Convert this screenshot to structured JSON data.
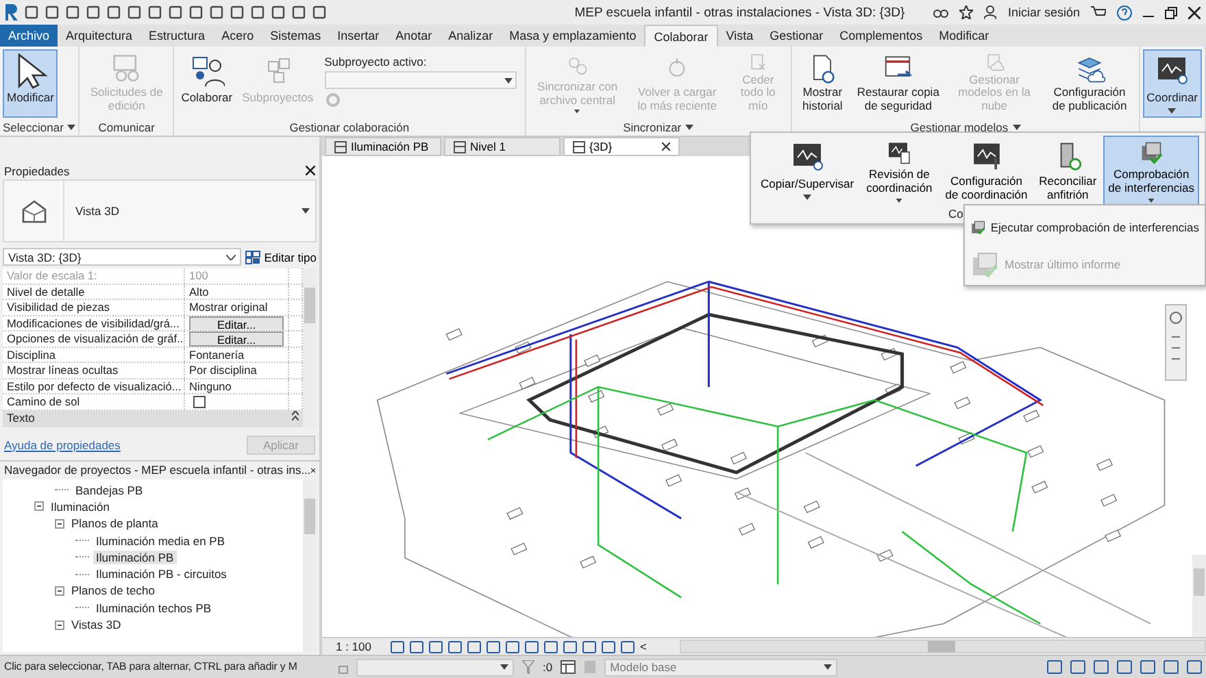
{
  "title_bar": {
    "title": "MEP escuela infantil - otras instalaciones - Vista 3D: {3D}",
    "sign_in": "Iniciar sesión"
  },
  "menu_tabs": [
    {
      "label": "Archivo",
      "kind": "file",
      "selected": false
    },
    {
      "label": "Arquitectura",
      "kind": "tab",
      "selected": false
    },
    {
      "label": "Estructura",
      "kind": "tab",
      "selected": false
    },
    {
      "label": "Acero",
      "kind": "tab",
      "selected": false
    },
    {
      "label": "Sistemas",
      "kind": "tab",
      "selected": false
    },
    {
      "label": "Insertar",
      "kind": "tab",
      "selected": false
    },
    {
      "label": "Anotar",
      "kind": "tab",
      "selected": false
    },
    {
      "label": "Analizar",
      "kind": "tab",
      "selected": false
    },
    {
      "label": "Masa y emplazamiento",
      "kind": "tab",
      "selected": false
    },
    {
      "label": "Colaborar",
      "kind": "tab",
      "selected": true
    },
    {
      "label": "Vista",
      "kind": "tab",
      "selected": false
    },
    {
      "label": "Gestionar",
      "kind": "tab",
      "selected": false
    },
    {
      "label": "Complementos",
      "kind": "tab",
      "selected": false
    },
    {
      "label": "Modificar",
      "kind": "tab",
      "selected": false
    }
  ],
  "ribbon": {
    "groups": [
      {
        "title": "Seleccionar",
        "has_menu": true,
        "buttons": [
          {
            "kind": "large",
            "label": "Modificar",
            "selected": true,
            "disabled": false
          }
        ]
      },
      {
        "title": "Comunicar",
        "buttons": [
          {
            "kind": "large",
            "label": "Solicitudes de edición",
            "selected": false,
            "disabled": true
          }
        ]
      },
      {
        "title": "Gestionar colaboración",
        "buttons": [
          {
            "kind": "large",
            "label": "Colaborar",
            "selected": false,
            "disabled": false
          },
          {
            "kind": "large",
            "label": "Subproyectos",
            "selected": false,
            "disabled": true
          },
          {
            "kind": "dropdown",
            "label": "Subproyecto activo:",
            "disabled": true
          }
        ]
      },
      {
        "title": "Sincronizar",
        "has_menu": true,
        "buttons": [
          {
            "kind": "large",
            "label": "Sincronizar con archivo central",
            "selected": false,
            "disabled": true,
            "has_menu": true
          },
          {
            "kind": "large",
            "label": "Volver a cargar lo más reciente",
            "selected": false,
            "disabled": true
          },
          {
            "kind": "large",
            "label": "Ceder todo lo mío",
            "selected": false,
            "disabled": true
          }
        ]
      },
      {
        "title": "Gestionar modelos",
        "has_menu": true,
        "buttons": [
          {
            "kind": "large",
            "label": "Mostrar historial",
            "selected": false,
            "disabled": false
          },
          {
            "kind": "large",
            "label": "Restaurar copia de seguridad",
            "selected": false,
            "disabled": false
          },
          {
            "kind": "large",
            "label": "Gestionar modelos en la nube",
            "selected": false,
            "disabled": true
          },
          {
            "kind": "large",
            "label": "Configuración de publicación",
            "selected": false,
            "disabled": false
          }
        ]
      },
      {
        "buttons": [
          {
            "kind": "large",
            "label": "Coordinar",
            "selected": true,
            "disabled": false,
            "has_menu": true
          }
        ]
      }
    ]
  },
  "coordinate_panel": {
    "title": "Co",
    "buttons": [
      {
        "label": "Copiar/Supervisar",
        "selected": false,
        "has_menu": true
      },
      {
        "label": "Revisión de coordinación",
        "selected": false,
        "has_menu": true
      },
      {
        "label": "Configuración de coordinación",
        "selected": false
      },
      {
        "label": "Reconciliar anfitrión",
        "selected": false
      },
      {
        "label": "Comprobación de interferencias",
        "selected": true,
        "has_menu": true
      }
    ],
    "menu": [
      {
        "label": "Ejecutar comprobación de interferencias",
        "disabled": false
      },
      {
        "label": "Mostrar último informe",
        "disabled": true
      }
    ]
  },
  "view_tabs": [
    {
      "label": "Iluminación PB",
      "selected": false
    },
    {
      "label": "Nivel 1",
      "selected": false
    },
    {
      "label": "{3D}",
      "selected": true
    }
  ],
  "properties": {
    "title": "Propiedades",
    "type_name": "Vista 3D",
    "instance": "Vista 3D: {3D}",
    "edit_type": "Editar tipo",
    "rows": [
      {
        "kind": "text",
        "name": "Valor de escala    1:",
        "value": "100",
        "disabled": true
      },
      {
        "kind": "text",
        "name": "Nivel de detalle",
        "value": "Alto",
        "disabled": false
      },
      {
        "kind": "text",
        "name": "Visibilidad de piezas",
        "value": "Mostrar original",
        "disabled": false
      },
      {
        "kind": "button",
        "name": "Modificaciones de visibilidad/grá...",
        "value": "Editar...",
        "disabled": false
      },
      {
        "kind": "button",
        "name": "Opciones de visualización de gráf...",
        "value": "Editar...",
        "disabled": false
      },
      {
        "kind": "text",
        "name": "Disciplina",
        "value": "Fontanería",
        "disabled": false
      },
      {
        "kind": "text",
        "name": "Mostrar líneas ocultas",
        "value": "Por disciplina",
        "disabled": false
      },
      {
        "kind": "text",
        "name": "Estilo por defecto de visualizació...",
        "value": "Ninguno",
        "disabled": false
      },
      {
        "kind": "checkbox",
        "name": "Camino de sol",
        "checked": false,
        "disabled": false
      }
    ],
    "section": "Texto",
    "help": "Ayuda de propiedades",
    "apply": "Aplicar",
    "apply_disabled": true
  },
  "project_browser": {
    "title": "Navegador de proyectos - MEP escuela infantil - otras ins...",
    "tree": [
      {
        "children": [
          {
            "children": [
              {
                "label": "Bandejas PB",
                "selected": false
              }
            ]
          },
          {
            "label": "Iluminación",
            "expanded": true,
            "selected": false,
            "children": [
              {
                "label": "Planos de planta",
                "expanded": true,
                "selected": false,
                "children": [
                  {
                    "label": "Iluminación media en PB",
                    "selected": false
                  },
                  {
                    "label": "Iluminación PB",
                    "selected": true
                  },
                  {
                    "label": "Iluminación PB - circuitos",
                    "selected": false
                  }
                ]
              },
              {
                "label": "Planos de techo",
                "expanded": true,
                "selected": false,
                "children": [
                  {
                    "label": "Iluminación techos PB",
                    "selected": false
                  }
                ]
              },
              {
                "label": "Vistas 3D",
                "expanded": true,
                "selected": false
              }
            ]
          }
        ]
      }
    ]
  },
  "view_bar": {
    "scale": "1 : 100",
    "more": "<"
  },
  "status_bar": {
    "message": "Clic para seleccionar, TAB para alternar, CTRL para añadir y M",
    "selection_count": ":0",
    "model": "Modelo base"
  }
}
